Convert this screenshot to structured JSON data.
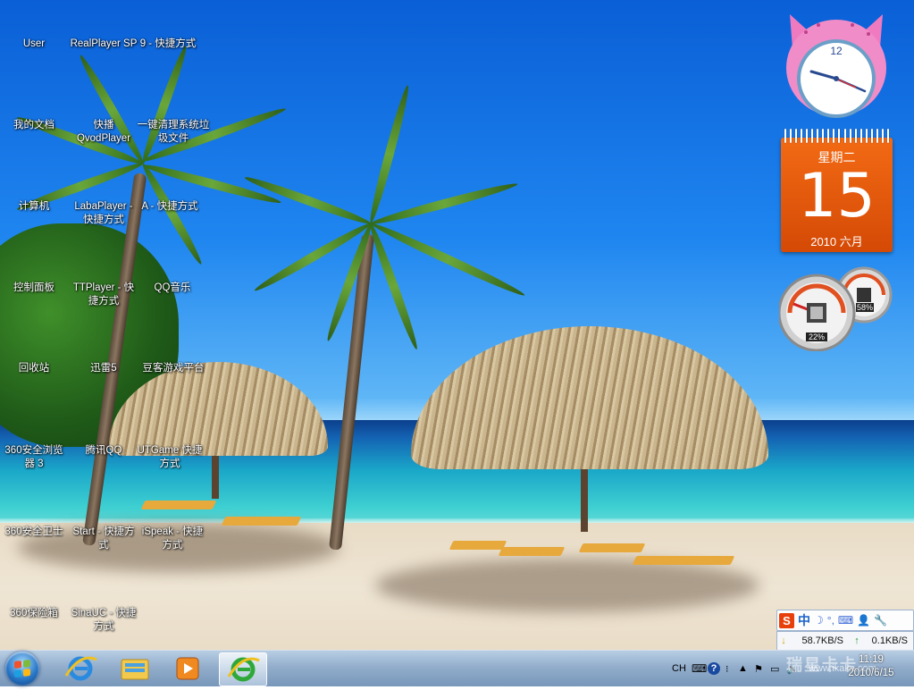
{
  "desktop": {
    "icons": [
      {
        "label": "User"
      },
      {
        "label": "RealPlayer SP"
      },
      {
        "label": "9 - 快捷方式"
      },
      {
        "label": "我的文档"
      },
      {
        "label": "快播 QvodPlayer"
      },
      {
        "label": "一键清理系统垃圾文件"
      },
      {
        "label": "计算机"
      },
      {
        "label": "LabaPlayer - 快捷方式"
      },
      {
        "label": "A - 快捷方式"
      },
      {
        "label": "控制面板"
      },
      {
        "label": "TTPlayer - 快捷方式"
      },
      {
        "label": "QQ音乐"
      },
      {
        "label": "回收站"
      },
      {
        "label": "迅雷5"
      },
      {
        "label": "豆客游戏平台"
      },
      {
        "label": "360安全浏览器 3"
      },
      {
        "label": "腾讯QQ"
      },
      {
        "label": "UTGame 快捷方式"
      },
      {
        "label": "360安全卫士"
      },
      {
        "label": "Start - 快捷方式"
      },
      {
        "label": "iSpeak - 快捷方式"
      },
      {
        "label": "360保险箱"
      },
      {
        "label": "SinaUC - 快捷方式"
      }
    ]
  },
  "gadgets": {
    "clock": {
      "numeral": "12"
    },
    "calendar": {
      "weekday": "星期二",
      "day": "15",
      "month": "2010 六月"
    },
    "cpu_meter": {
      "cpu": "22%",
      "memory": "58%"
    }
  },
  "ime_bar": {
    "logo": "S",
    "mode": "中",
    "moon": "☽",
    "punct": "°,",
    "keyboard": "⌨",
    "user": "👤",
    "tool": "🔧"
  },
  "netspeed": {
    "down_arrow": "↓",
    "down": "58.7KB/S",
    "up_arrow": "↑",
    "up": "0.1KB/S"
  },
  "taskbar": {
    "language": "CH",
    "help": "?",
    "time": "11:19",
    "date": "2010/6/15",
    "watermark": "瑞星卡卡",
    "watermark_url": "www.ikaka.com"
  },
  "colors": {
    "calendar": "#e8560c",
    "taskbar": "#8aa8c8",
    "sea": "#1aa7c9"
  }
}
